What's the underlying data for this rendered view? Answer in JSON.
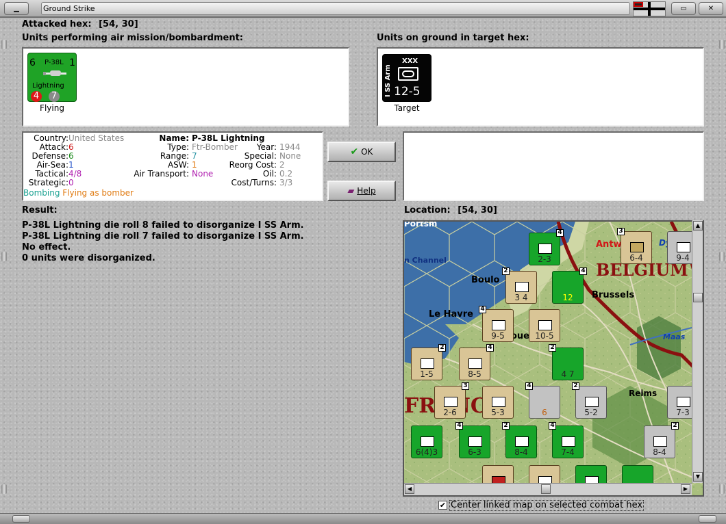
{
  "window": {
    "title": "Ground Strike"
  },
  "attacked_hex": {
    "label": "Attacked hex:",
    "value": "[54, 30]"
  },
  "air_units_panel": {
    "label": "Units performing air mission/bombardment:",
    "unit": {
      "name": "P-38L",
      "subname": "Lightning",
      "range": "6",
      "count": "1",
      "attack": "4",
      "defense": "7",
      "caption": "Flying"
    }
  },
  "ground_units_panel": {
    "label": "Units on ground in target hex:",
    "unit": {
      "name": "I SS Arm",
      "size": "XXX",
      "strength": "12-5",
      "caption": "Target"
    }
  },
  "unit_info": {
    "country_label": "Country:",
    "country": "United States",
    "attack_label": "Attack:",
    "attack": "6",
    "defense_label": "Defense:",
    "defense": "6",
    "airsea_label": "Air-Sea:",
    "airsea": "1",
    "tactical_label": "Tactical:",
    "tactical": "4/8",
    "strategic_label": "Strategic:",
    "strategic": "0",
    "mission": "Bombing",
    "mission_mode": "Flying as bomber",
    "name_label": "Name:",
    "name": "P-38L Lightning",
    "type_label": "Type:",
    "type": "Ftr-Bomber",
    "range_label": "Range:",
    "range": "7",
    "asw_label": "ASW:",
    "asw": "1",
    "air_transport_label": "Air Transport:",
    "air_transport": "None",
    "year_label": "Year:",
    "year": "1944",
    "special_label": "Special:",
    "special": "None",
    "reorg_label": "Reorg Cost:",
    "reorg": "2",
    "oil_label": "Oil:",
    "oil": "0.2",
    "cost_label": "Cost/Turns:",
    "cost": "3/3"
  },
  "buttons": {
    "ok": "OK",
    "help": "Help"
  },
  "result": {
    "label": "Result:",
    "lines": [
      "P-38L Lightning die roll 8 failed to disorganize I SS Arm.",
      "P-38L Lightning die roll 7 failed to disorganize I SS Arm.",
      "No effect.",
      "0 units were disorganized."
    ]
  },
  "location": {
    "label": "Location:",
    "value": "[54, 30]"
  },
  "map": {
    "labels": {
      "channel": "n Channel",
      "belgium": "BELGIUM",
      "antwerp": "Antw",
      "brussels": "Brussels",
      "boulogne": "Boulo",
      "le_havre": "Le Havre",
      "reims": "Reims",
      "maas": "Maas",
      "france": "FRANC",
      "portsmouth": "Portsm",
      "dy": "Dy",
      "oue": "oue"
    },
    "counters": [
      {
        "str": "2-3",
        "stack": "4"
      },
      {
        "str": "6-4",
        "stack": "3"
      },
      {
        "str": "9-4",
        "stack": ""
      },
      {
        "str": "3  4",
        "stack": "2"
      },
      {
        "str": "12",
        "stack": "4"
      },
      {
        "str": "9-5",
        "stack": "4"
      },
      {
        "str": "10-5",
        "stack": ""
      },
      {
        "str": "1-5",
        "stack": "2"
      },
      {
        "str": "8-5",
        "stack": "4"
      },
      {
        "str": "4  7",
        "stack": "2"
      },
      {
        "str": "2-6",
        "stack": "3"
      },
      {
        "str": "5-3",
        "stack": ""
      },
      {
        "str": "6",
        "stack": "4"
      },
      {
        "str": "5-2",
        "stack": "2"
      },
      {
        "str": "7-3",
        "stack": ""
      },
      {
        "str": "6(4)3",
        "stack": ""
      },
      {
        "str": "6-3",
        "stack": "4"
      },
      {
        "str": "8-4",
        "stack": "2"
      },
      {
        "str": "7-4",
        "stack": "4"
      },
      {
        "str": "8-4",
        "stack": "2"
      }
    ]
  },
  "checkbox": {
    "label": "Center linked map on selected combat hex",
    "checked": true
  },
  "colors": {
    "air_unit_green": "#1fa326",
    "ss_black": "#050505",
    "border_red": "#8a1010"
  }
}
